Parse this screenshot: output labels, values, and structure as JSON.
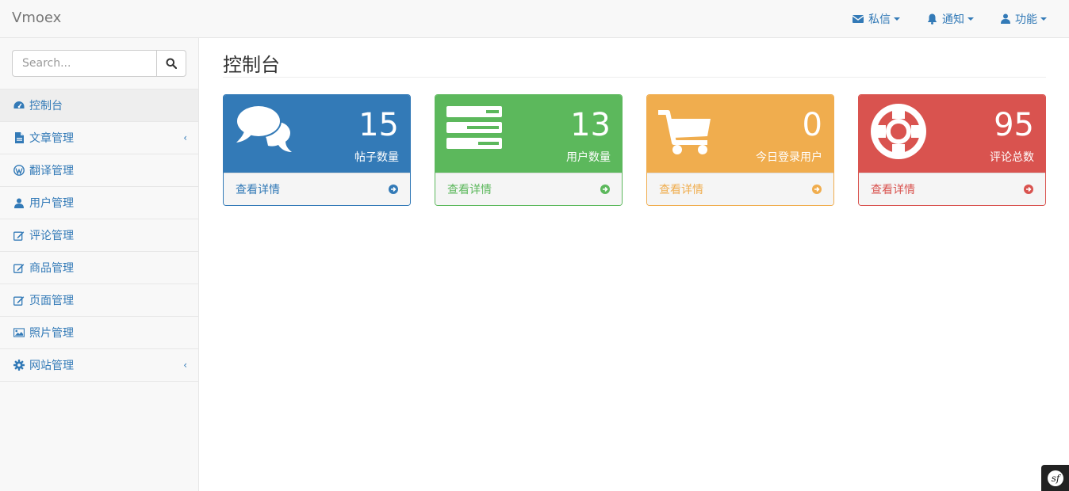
{
  "app": {
    "brand": "Vmoex"
  },
  "navbar": {
    "items": [
      {
        "label": "私信",
        "icon": "envelope-icon"
      },
      {
        "label": "通知",
        "icon": "bell-icon"
      },
      {
        "label": "功能",
        "icon": "user-icon"
      }
    ]
  },
  "sidebar": {
    "search": {
      "placeholder": "Search...",
      "value": ""
    },
    "items": [
      {
        "label": "控制台",
        "icon": "dashboard-icon",
        "active": true
      },
      {
        "label": "文章管理",
        "icon": "file-icon",
        "has_submenu": true
      },
      {
        "label": "翻译管理",
        "icon": "wordpress-icon"
      },
      {
        "label": "用户管理",
        "icon": "user-icon"
      },
      {
        "label": "评论管理",
        "icon": "edit-icon"
      },
      {
        "label": "商品管理",
        "icon": "edit-icon"
      },
      {
        "label": "页面管理",
        "icon": "edit-icon"
      },
      {
        "label": "照片管理",
        "icon": "image-icon"
      },
      {
        "label": "网站管理",
        "icon": "gear-icon",
        "has_submenu": true
      }
    ],
    "submenu_arrow": "‹"
  },
  "main": {
    "title": "控制台",
    "panels": [
      {
        "value": "15",
        "label": "帖子数量",
        "link": "查看详情",
        "icon": "comments-icon",
        "color": "#337ab7"
      },
      {
        "value": "13",
        "label": "用户数量",
        "link": "查看详情",
        "icon": "tasks-icon",
        "color": "#5cb85c"
      },
      {
        "value": "0",
        "label": "今日登录用户",
        "link": "查看详情",
        "icon": "shopping-cart-icon",
        "color": "#f0ad4e"
      },
      {
        "value": "95",
        "label": "评论总数",
        "link": "查看详情",
        "icon": "life-ring-icon",
        "color": "#d9534f"
      }
    ]
  },
  "debug_toolbar": {
    "glyph": "sf"
  }
}
